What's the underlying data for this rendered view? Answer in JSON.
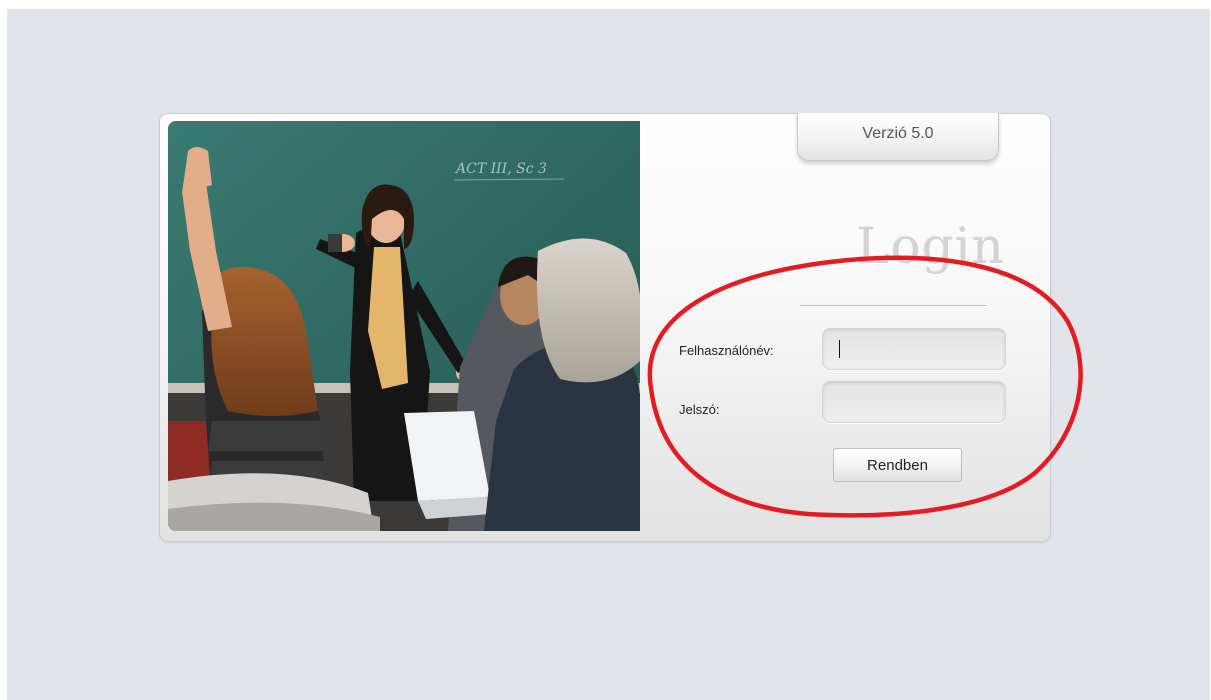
{
  "version_tab": {
    "label": "Verzió 5.0"
  },
  "login": {
    "title": "Login",
    "username_label": "Felhasználónév:",
    "username_value": "",
    "password_label": "Jelszó:",
    "password_value": "",
    "submit_label": "Rendben"
  },
  "colors": {
    "page_background": "#e1e5ea",
    "chalkboard": "#2e6a63",
    "annotation_circle": "#e41b23"
  },
  "photo": {
    "chalkboard_writing": "ACT III, Sc 3"
  }
}
